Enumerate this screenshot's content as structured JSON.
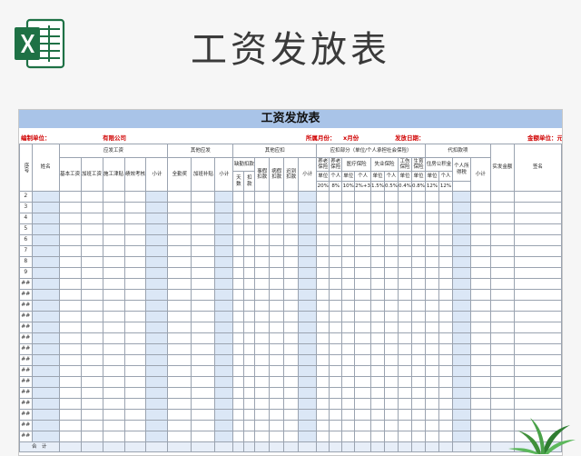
{
  "header": {
    "title": "工资发放表"
  },
  "sheet": {
    "title": "工资发放表",
    "info": {
      "unit_label": "编制单位：",
      "company": "有限公司",
      "month_label": "所属月份：",
      "month_value": "x月份",
      "date_label": "发放日期：",
      "currency_label": "金额单位：元"
    },
    "columns": {
      "seq": "序号",
      "name": "姓名",
      "g_payable": "应发工资",
      "base": "基本工资",
      "overtime": "加班工资",
      "seniority": "施工津贴",
      "performance": "绩效考核",
      "subtotal": "小计",
      "g_other_pay": "其他应发",
      "attendance_bonus": "全勤奖",
      "overtime_allowance": "加班补贴",
      "g_other_deduct": "其他应扣",
      "absence": "缺勤扣款",
      "days": "天数",
      "deduct": "扣款",
      "personal_leave": "事假扣款",
      "sick_leave": "病假扣款",
      "late": "迟到扣款",
      "g_withheld": "应扣部分（单位/个人承担社会保险）",
      "pension_unit": "养老保险",
      "pension_personal": "养老保险",
      "medical": "医疗保险",
      "unemployment": "失业保险",
      "injury": "工伤保险",
      "maternity": "生育保险",
      "unit": "单位",
      "personal": "个人",
      "g_withholding": "代扣款项",
      "housing_fund": "住房公积金",
      "income_tax": "个人所得税",
      "net_pay": "实发金额",
      "signature": "签名"
    },
    "rates": {
      "pension_unit": "20%",
      "pension_personal": "8%",
      "medical_unit": "10%",
      "medical_personal": "2%+3",
      "unemployment_unit": "1.5%",
      "unemployment_personal": "0.5%",
      "injury_unit": "0.4%",
      "maternity_unit": "0.8%",
      "housing_unit": "12%",
      "housing_personal": "12%"
    },
    "row_numbers": [
      "2",
      "3",
      "4",
      "5",
      "6",
      "7",
      "8",
      "9",
      "##",
      "##",
      "##",
      "##",
      "##",
      "##",
      "##",
      "##",
      "##",
      "##",
      "##",
      "##",
      "##",
      "##",
      "##"
    ],
    "total_label": "合　计"
  }
}
